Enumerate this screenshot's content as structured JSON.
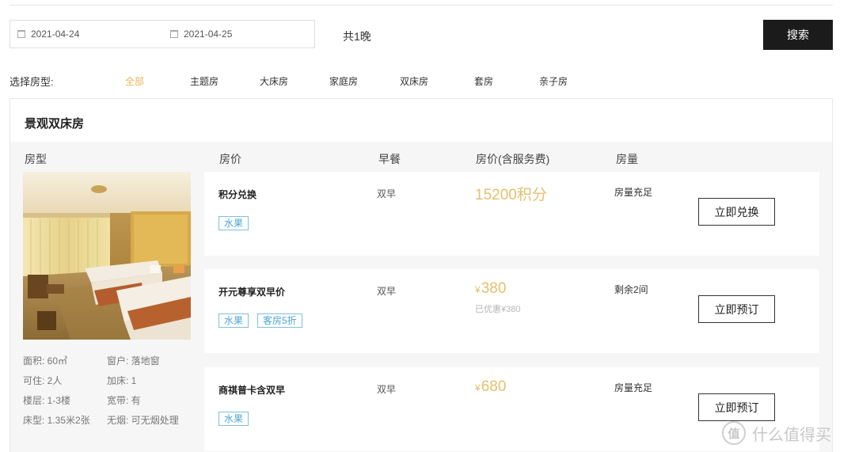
{
  "search_bar": {
    "checkin": "2021-04-24",
    "checkout": "2021-04-25",
    "nights": "共1晚",
    "search_label": "搜索"
  },
  "room_filter": {
    "label": "选择房型:",
    "tabs": [
      "全部",
      "主题房",
      "大床房",
      "家庭房",
      "双床房",
      "套房",
      "亲子房"
    ],
    "active_index": 0,
    "active_color": "#e4b95a"
  },
  "room_card": {
    "title": "景观双床房",
    "columns": [
      "房型",
      "房价",
      "早餐",
      "房价(含服务费)",
      "房量"
    ],
    "image": "hotel-twin-room-photo",
    "specs": [
      {
        "label": "面积",
        "value": "60㎡"
      },
      {
        "label": "窗户",
        "value": "落地窗"
      },
      {
        "label": "可住",
        "value": "2人"
      },
      {
        "label": "加床",
        "value": "1"
      },
      {
        "label": "楼层",
        "value": "1-3楼"
      },
      {
        "label": "宽带",
        "value": "有"
      },
      {
        "label": "床型",
        "value": "1.35米2张"
      },
      {
        "label": "无烟",
        "value": "可无烟处理"
      }
    ],
    "spec_text": [
      "面积: 60㎡",
      "窗户: 落地窗",
      "可住: 2人",
      "加床: 1",
      "楼层: 1-3楼",
      "宽带: 有",
      "床型: 1.35米2张",
      "无烟: 可无烟处理"
    ],
    "offers": [
      {
        "name": "积分兑换",
        "breakfast": "双早",
        "price_symbol": "",
        "price": "15200积分",
        "discount": "",
        "stock": "房量充足",
        "tags": [
          "水果"
        ],
        "button": "立即兑换"
      },
      {
        "name": "开元尊享双早价",
        "breakfast": "双早",
        "price_symbol": "¥",
        "price": "380",
        "discount": "已优惠¥380",
        "stock": "剩余2间",
        "tags": [
          "水果",
          "客房5折"
        ],
        "button": "立即预订"
      },
      {
        "name": "商祺普卡含双早",
        "breakfast": "双早",
        "price_symbol": "¥",
        "price": "680",
        "discount": "",
        "stock": "房量充足",
        "tags": [
          "水果"
        ],
        "button": "立即预订"
      }
    ]
  },
  "watermark": {
    "logo_char": "值",
    "text": "什么值得买"
  },
  "colors": {
    "price": "#e4c06e",
    "tag": "#4fa6cf",
    "button_dark": "#1b1b1b"
  }
}
